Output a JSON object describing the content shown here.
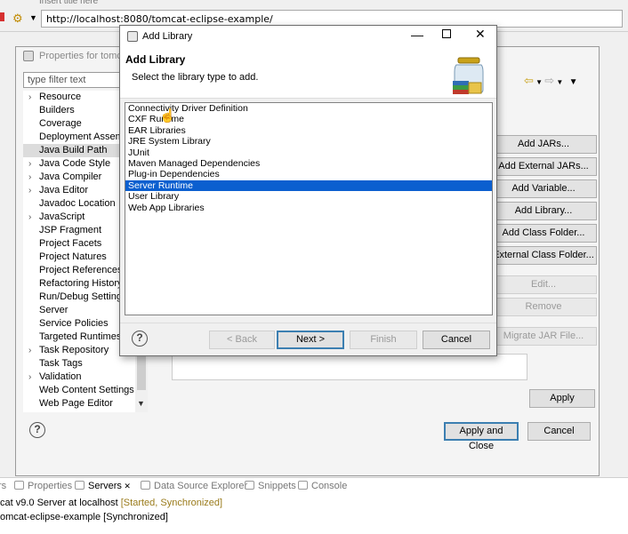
{
  "browser": {
    "tab_title": "Insert title here",
    "url": "http://localhost:8080/tomcat-eclipse-example/"
  },
  "properties": {
    "title": "Properties for tomca",
    "filter_placeholder": "type filter text",
    "tree_items": [
      {
        "label": "Resource",
        "expandable": true
      },
      {
        "label": "Builders",
        "expandable": false
      },
      {
        "label": "Coverage",
        "expandable": false
      },
      {
        "label": "Deployment Assemb",
        "expandable": false
      },
      {
        "label": "Java Build Path",
        "expandable": false,
        "selected": true
      },
      {
        "label": "Java Code Style",
        "expandable": true
      },
      {
        "label": "Java Compiler",
        "expandable": true
      },
      {
        "label": "Java Editor",
        "expandable": true
      },
      {
        "label": "Javadoc Location",
        "expandable": false
      },
      {
        "label": "JavaScript",
        "expandable": true
      },
      {
        "label": "JSP Fragment",
        "expandable": false
      },
      {
        "label": "Project Facets",
        "expandable": false
      },
      {
        "label": "Project Natures",
        "expandable": false
      },
      {
        "label": "Project References",
        "expandable": false
      },
      {
        "label": "Refactoring History",
        "expandable": false
      },
      {
        "label": "Run/Debug Settings",
        "expandable": false
      },
      {
        "label": "Server",
        "expandable": false
      },
      {
        "label": "Service Policies",
        "expandable": false
      },
      {
        "label": "Targeted Runtimes",
        "expandable": false
      },
      {
        "label": "Task Repository",
        "expandable": true
      },
      {
        "label": "Task Tags",
        "expandable": false
      },
      {
        "label": "Validation",
        "expandable": true
      },
      {
        "label": "Web Content Settings",
        "expandable": false
      },
      {
        "label": "Web Page Editor",
        "expandable": false
      }
    ],
    "side_buttons": {
      "add_jars": "Add JARs...",
      "add_external_jars": "Add External JARs...",
      "add_variable": "Add Variable...",
      "add_library": "Add Library...",
      "add_class_folder": "Add Class Folder...",
      "external_class_folder": "External Class Folder...",
      "edit": "Edit...",
      "remove": "Remove",
      "migrate_jar": "Migrate JAR File..."
    },
    "apply": "Apply",
    "apply_and_close": "Apply and Close",
    "cancel": "Cancel"
  },
  "dialog": {
    "title": "Add Library",
    "heading": "Add Library",
    "description": "Select the library type to add.",
    "libraries": [
      "Connectivity Driver Definition",
      "CXF Runtime",
      "EAR Libraries",
      "JRE System Library",
      "JUnit",
      "Maven Managed Dependencies",
      "Plug-in Dependencies",
      "Server Runtime",
      "User Library",
      "Web App Libraries"
    ],
    "selected_library": "Server Runtime",
    "buttons": {
      "back": "< Back",
      "next": "Next >",
      "finish": "Finish",
      "cancel": "Cancel"
    }
  },
  "bottom_panel": {
    "tabs": [
      {
        "label": "rs",
        "icon": "markers-icon"
      },
      {
        "label": "Properties",
        "icon": "properties-icon"
      },
      {
        "label": "Servers",
        "icon": "servers-icon",
        "active": true
      },
      {
        "label": "Data Source Explorer",
        "icon": "database-icon"
      },
      {
        "label": "Snippets",
        "icon": "snippets-icon"
      },
      {
        "label": "Console",
        "icon": "console-icon"
      }
    ],
    "server_name": "cat v9.0 Server at localhost",
    "server_status": "[Started, Synchronized]",
    "module_name": "omcat-eclipse-example",
    "module_status": "[Synchronized]"
  },
  "colors": {
    "selection": "#0b5fcf",
    "default_button_border": "#3c7fb1",
    "status_text": "#9a7b1b"
  }
}
